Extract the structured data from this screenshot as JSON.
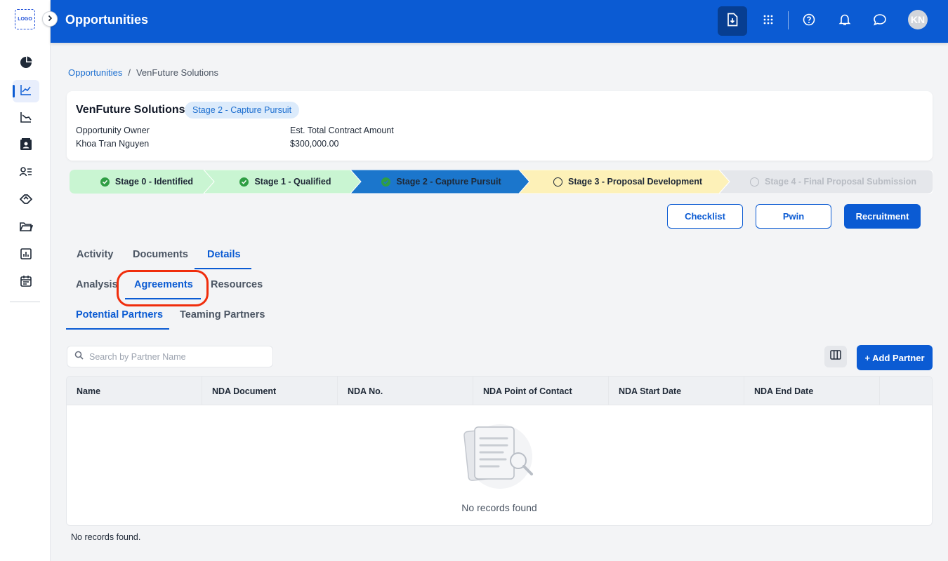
{
  "colors": {
    "primary": "#0b5bd3",
    "header_bg": "#0b5bd3",
    "stage_done": "#c9f5d2",
    "stage_current": "#1b76cc",
    "stage_next": "#fdf1b8",
    "stage_future": "#e5e7eb",
    "highlight": "#f02d0c"
  },
  "sidebar": {
    "logo_text": "LOGO",
    "items": [
      {
        "icon": "pie-chart-icon"
      },
      {
        "icon": "line-chart-icon",
        "active": true
      },
      {
        "icon": "trend-chart-icon"
      },
      {
        "icon": "contact-card-icon"
      },
      {
        "icon": "people-list-icon"
      },
      {
        "icon": "handshake-icon"
      },
      {
        "icon": "folder-icon"
      },
      {
        "icon": "bar-report-icon"
      },
      {
        "icon": "calendar-icon"
      }
    ]
  },
  "header": {
    "title": "Opportunities",
    "avatar_initials": "KN",
    "icons": [
      "download-file-icon",
      "apps-grid-icon",
      "help-icon",
      "bell-icon",
      "chat-icon"
    ]
  },
  "breadcrumb": {
    "parent": "Opportunities",
    "separator": "/",
    "current": "VenFuture Solutions"
  },
  "opportunity": {
    "name": "VenFuture Solutions",
    "stage_badge": "Stage 2 - Capture Pursuit",
    "owner_label": "Opportunity Owner",
    "owner_value": "Khoa Tran Nguyen",
    "amount_label": "Est. Total Contract Amount",
    "amount_value": "$300,000.00"
  },
  "stages": [
    {
      "label": "Stage 0 - Identified",
      "status": "done"
    },
    {
      "label": "Stage 1 - Qualified",
      "status": "done"
    },
    {
      "label": "Stage 2 - Capture Pursuit",
      "status": "current"
    },
    {
      "label": "Stage 3 - Proposal Development",
      "status": "next"
    },
    {
      "label": "Stage 4 - Final Proposal Submission",
      "status": "future"
    }
  ],
  "actions": {
    "checklist": "Checklist",
    "pwin": "Pwin",
    "recruitment": "Recruitment"
  },
  "tabs_main": [
    "Activity",
    "Documents",
    "Details"
  ],
  "tabs_main_active": "Details",
  "tabs_sub": [
    "Analysis",
    "Agreements",
    "Resources"
  ],
  "tabs_sub_active": "Agreements",
  "tabs_partner": [
    "Potential Partners",
    "Teaming Partners"
  ],
  "tabs_partner_active": "Potential Partners",
  "search": {
    "placeholder": "Search by Partner Name",
    "value": ""
  },
  "add_partner_label": "+ Add Partner",
  "table": {
    "columns": [
      "Name",
      "NDA Document",
      "NDA No.",
      "NDA Point of Contact",
      "NDA Start Date",
      "NDA End Date"
    ],
    "rows": [],
    "empty_message": "No records found"
  },
  "footer_text": "No records found."
}
